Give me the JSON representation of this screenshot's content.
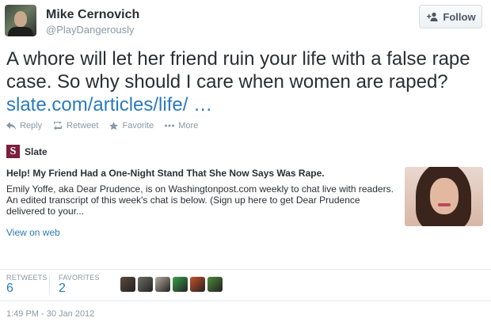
{
  "user": {
    "name": "Mike Cernovich",
    "handle": "@PlayDangerously",
    "follow_label": "Follow"
  },
  "tweet": {
    "text": "A whore will let her friend ruin your life with a false rape case. So why should I care when women are raped?",
    "link_text": "slate.com/articles/life/ …"
  },
  "actions": [
    {
      "label": "Reply",
      "icon": "reply-icon"
    },
    {
      "label": "Retweet",
      "icon": "retweet-icon"
    },
    {
      "label": "Favorite",
      "icon": "star-icon"
    },
    {
      "label": "More",
      "icon": "more-dots-icon"
    }
  ],
  "card": {
    "source_logo": "S",
    "source_name": "Slate",
    "title": "Help! My Friend Had a One-Night Stand That She Now Says Was Rape.",
    "description": "Emily Yoffe, aka Dear Prudence, is on Washingtonpost.com weekly to chat live with readers. An edited transcript of this week's chat is below. (Sign up here to get Dear Prudence delivered to your...",
    "view_label": "View on web"
  },
  "stats": {
    "retweets_label": "RETWEETS",
    "retweets_value": "6",
    "favorites_label": "FAVORITES",
    "favorites_value": "2"
  },
  "favoriter_avatars": [
    "#5a4a3a",
    "#6e6e66",
    "#b7aca0",
    "#3aa04a",
    "#c8502a",
    "#4e8a3a"
  ],
  "timestamp": "1:49 PM - 30 Jan 2012",
  "colors": {
    "link": "#2b7bb9",
    "muted": "#8899a6",
    "text": "#292f33",
    "slate_brand": "#7a1f3d"
  }
}
